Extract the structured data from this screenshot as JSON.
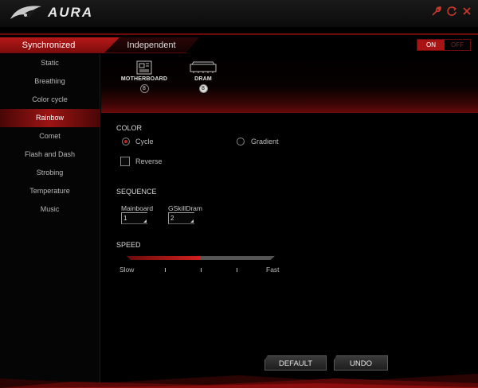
{
  "window": {
    "title": "AURA"
  },
  "titlebar_icons": [
    "wrench-icon",
    "refresh-icon",
    "close-icon"
  ],
  "tabs": [
    {
      "label": "Synchronized",
      "active": true
    },
    {
      "label": "Independent",
      "active": false
    }
  ],
  "power_toggle": {
    "on_label": "ON",
    "off_label": "OFF",
    "state": "ON"
  },
  "sidebar": {
    "items": [
      {
        "label": "Static"
      },
      {
        "label": "Breathing"
      },
      {
        "label": "Color cycle"
      },
      {
        "label": "Rainbow",
        "active": true
      },
      {
        "label": "Comet"
      },
      {
        "label": "Flash and Dash"
      },
      {
        "label": "Strobing"
      },
      {
        "label": "Temperature"
      },
      {
        "label": "Music"
      }
    ]
  },
  "devices": [
    {
      "label": "MOTHERBOARD",
      "badge": "8",
      "icon": "motherboard-icon"
    },
    {
      "label": "DRAM",
      "badge": "8",
      "icon": "dram-icon"
    }
  ],
  "color": {
    "section_label": "COLOR",
    "options": [
      {
        "label": "Cycle",
        "selected": true
      },
      {
        "label": "Gradient",
        "selected": false
      }
    ],
    "reverse_label": "Reverse",
    "reverse_checked": false
  },
  "sequence": {
    "section_label": "SEQUENCE",
    "items": [
      {
        "label": "Mainboard",
        "value": "1"
      },
      {
        "label": "GSkillDram",
        "value": "2"
      }
    ]
  },
  "speed": {
    "section_label": "SPEED",
    "min_label": "Slow",
    "max_label": "Fast",
    "level_fraction": 0.5
  },
  "buttons": {
    "default_label": "DEFAULT",
    "undo_label": "UNDO"
  },
  "colors": {
    "accent": "#a81414",
    "background": "#000000",
    "text": "#cfcfcf"
  }
}
